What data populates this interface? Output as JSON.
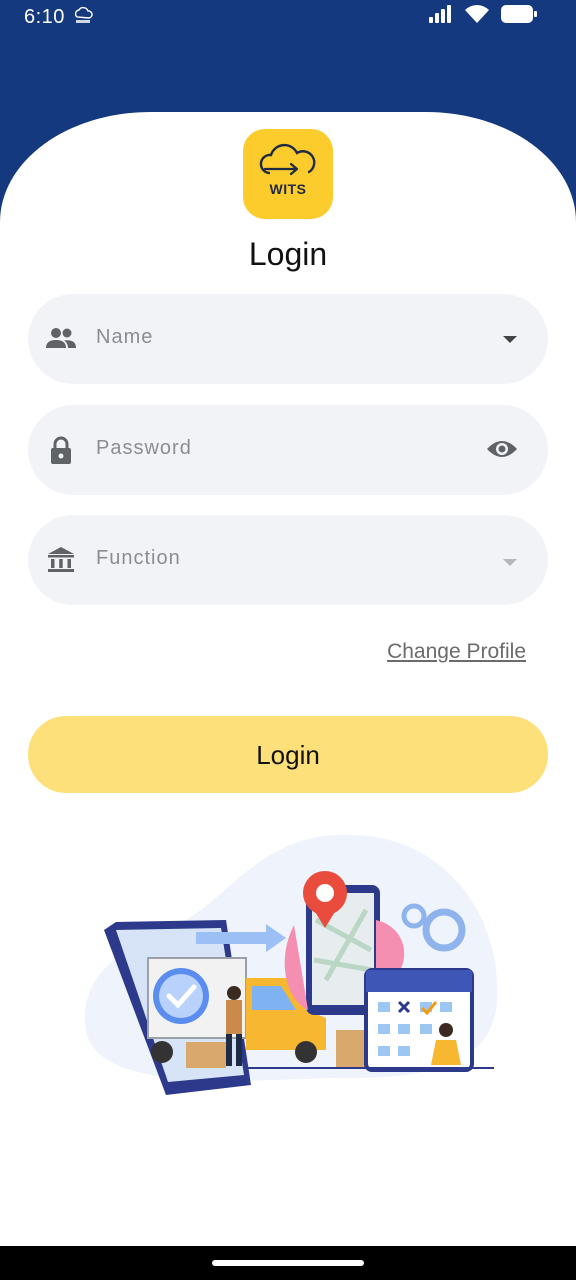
{
  "status_bar": {
    "time": "6:10",
    "notification_icon": "wits-cloud-icon",
    "icons": [
      "signal-icon",
      "wifi-icon",
      "battery-icon"
    ]
  },
  "logo": {
    "text": "WITS",
    "color": "#fccb2c"
  },
  "title": "Login",
  "fields": {
    "name": {
      "placeholder": "Name",
      "icon": "people-icon",
      "trailing_icon": "dropdown-arrow-icon"
    },
    "password": {
      "placeholder": "Password",
      "icon": "lock-icon",
      "trailing_icon": "eye-icon"
    },
    "function": {
      "placeholder": "Function",
      "icon": "bank-icon",
      "trailing_icon": "dropdown-arrow-icon"
    }
  },
  "change_profile_label": "Change Profile",
  "login_button_label": "Login",
  "colors": {
    "header": "#15397f",
    "button": "#fee07a",
    "field_bg": "#f1f3f7"
  }
}
